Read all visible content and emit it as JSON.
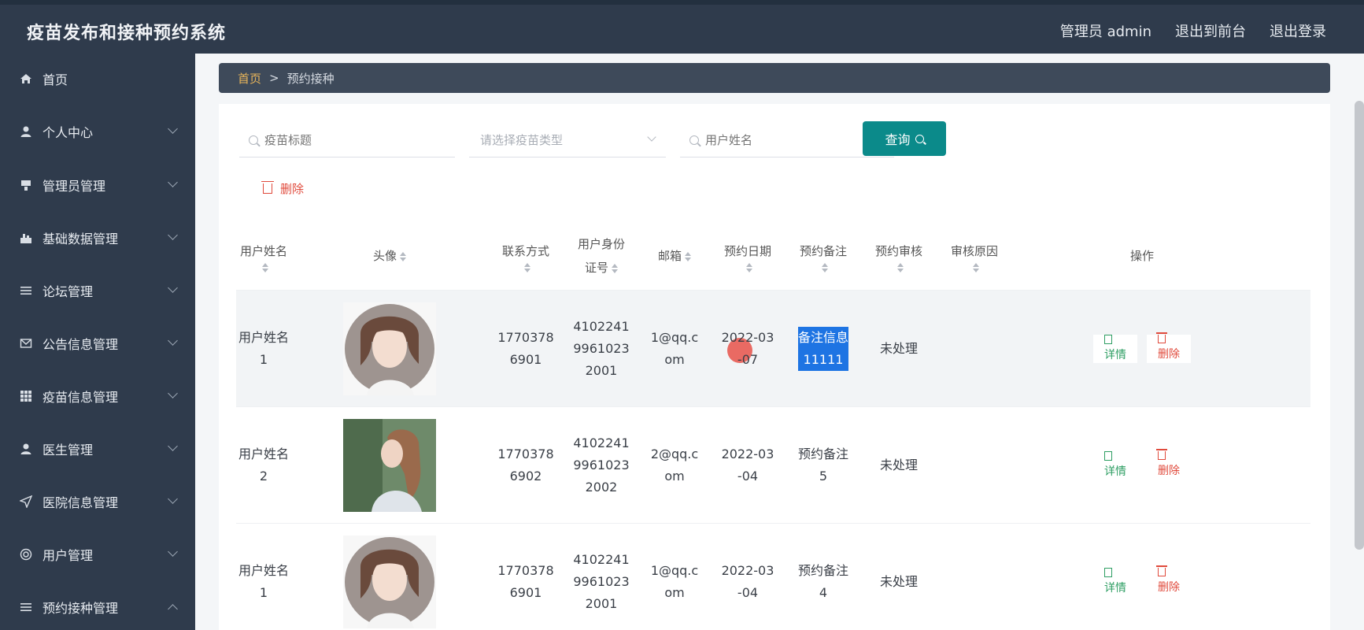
{
  "app": {
    "title": "疫苗发布和接种预约系统"
  },
  "top_links": [
    {
      "label": "管理员 admin"
    },
    {
      "label": "退出到前台"
    },
    {
      "label": "退出登录"
    }
  ],
  "sidebar": {
    "items": [
      {
        "label": "首页",
        "icon": "home-icon"
      },
      {
        "label": "个人中心",
        "icon": "user-icon"
      },
      {
        "label": "管理员管理",
        "icon": "admin-icon"
      },
      {
        "label": "基础数据管理",
        "icon": "data-icon"
      },
      {
        "label": "论坛管理",
        "icon": "list-icon"
      },
      {
        "label": "公告信息管理",
        "icon": "mail-icon"
      },
      {
        "label": "疫苗信息管理",
        "icon": "grid-icon"
      },
      {
        "label": "医生管理",
        "icon": "doctor-icon"
      },
      {
        "label": "医院信息管理",
        "icon": "send-icon"
      },
      {
        "label": "用户管理",
        "icon": "target-icon"
      },
      {
        "label": "预约接种管理",
        "icon": "list-icon"
      }
    ]
  },
  "breadcrumb": {
    "home": "首页",
    "separator": ">",
    "current": "预约接种"
  },
  "search": {
    "title_placeholder": "疫苗标题",
    "type_placeholder": "请选择疫苗类型",
    "name_placeholder": "用户姓名",
    "query_label": "查询"
  },
  "toolbar": {
    "delete_label": "删除"
  },
  "table": {
    "headers": {
      "name": "用户姓名",
      "avatar": "头像",
      "phone": "联系方式",
      "id_line1": "用户身份",
      "id_line2": "证号",
      "email": "邮箱",
      "date": "预约日期",
      "remark": "预约备注",
      "review": "预约审核",
      "reason": "审核原因",
      "ops": "操作"
    },
    "rows": [
      {
        "name_l1": "用户姓名",
        "name_l2": "1",
        "phone_l1": "1770378",
        "phone_l2": "6901",
        "id_l1": "4102241",
        "id_l2": "9961023",
        "id_l3": "2001",
        "email_l1": "1@qq.c",
        "email_l2": "om",
        "date_l1": "2022-03",
        "date_l2": "-07",
        "remark_l1": "备注信息",
        "remark_l2": "11111",
        "review": "未处理",
        "reason": "",
        "detail": "详情",
        "delete": "删除"
      },
      {
        "name_l1": "用户姓名",
        "name_l2": "2",
        "phone_l1": "1770378",
        "phone_l2": "6902",
        "id_l1": "4102241",
        "id_l2": "9961023",
        "id_l3": "2002",
        "email_l1": "2@qq.c",
        "email_l2": "om",
        "date_l1": "2022-03",
        "date_l2": "-04",
        "remark_l1": "预约备注",
        "remark_l2": "5",
        "review": "未处理",
        "reason": "",
        "detail": "详情",
        "delete": "删除"
      },
      {
        "name_l1": "用户姓名",
        "name_l2": "1",
        "phone_l1": "1770378",
        "phone_l2": "6901",
        "id_l1": "4102241",
        "id_l2": "9961023",
        "id_l3": "2001",
        "email_l1": "1@qq.c",
        "email_l2": "om",
        "date_l1": "2022-03",
        "date_l2": "-04",
        "remark_l1": "预约备注",
        "remark_l2": "4",
        "review": "未处理",
        "reason": "",
        "detail": "详情",
        "delete": "删除"
      }
    ]
  },
  "colors": {
    "topbar": "#2f3b4c",
    "breadcrumb": "#3e4a5a",
    "accent": "#0b8a8a",
    "danger": "#e04a3c",
    "success": "#2e9e63",
    "breadcrumb_home": "#e7b45a"
  }
}
